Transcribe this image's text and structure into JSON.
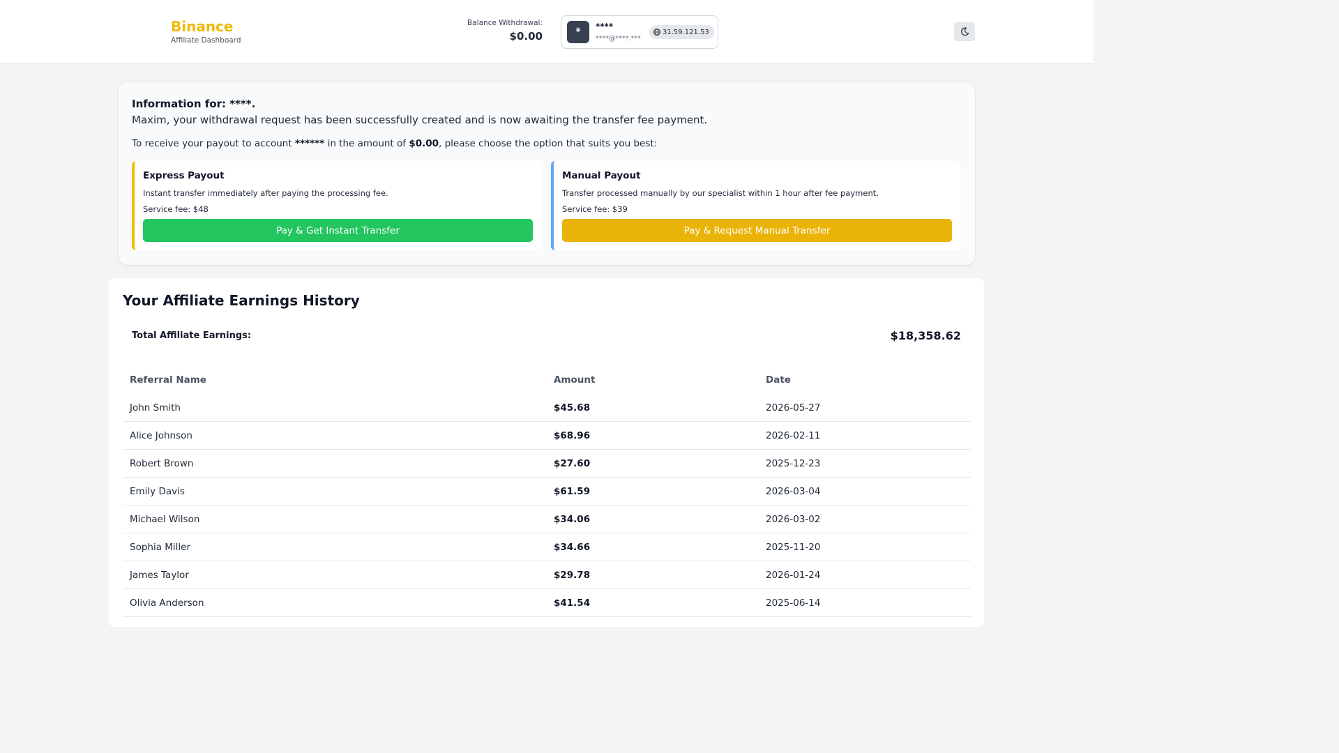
{
  "header": {
    "brand_name": "Binance",
    "brand_subtitle": "Affiliate Dashboard",
    "balance_label": "Balance Withdrawal:",
    "balance_value": "$0.00",
    "user": {
      "avatar_initial": "*",
      "name": "****",
      "email": "****@****.***",
      "ip": "31.59.121.53"
    },
    "theme_toggle_icon": "moon-icon"
  },
  "info": {
    "title": "Information for: ****.",
    "message": "Maxim, your withdrawal request has been successfully created and is now awaiting the transfer fee payment.",
    "line_prefix": "To receive your payout to account ",
    "account": "******",
    "line_middle": " in the amount of ",
    "amount": "$0.00",
    "line_suffix": ", please choose the option that suits you best:"
  },
  "options": {
    "express": {
      "title": "Express Payout",
      "description": "Instant transfer immediately after paying the processing fee.",
      "fee": "Service fee: $48",
      "button": "Pay & Get Instant Transfer",
      "accent": "#f0c000",
      "button_color": "#22c55e"
    },
    "manual": {
      "title": "Manual Payout",
      "description": "Transfer processed manually by our specialist within 1 hour after fee payment.",
      "fee": "Service fee: $39",
      "button": "Pay & Request Manual Transfer",
      "accent": "#60a5fa",
      "button_color": "#eab308"
    }
  },
  "history": {
    "title": "Your Affiliate Earnings History",
    "total_label": "Total Affiliate Earnings:",
    "total_value": "$18,358.62",
    "columns": [
      "Referral Name",
      "Amount",
      "Date"
    ],
    "rows": [
      {
        "name": "John Smith",
        "amount": "$45.68",
        "date": "2026-05-27"
      },
      {
        "name": "Alice Johnson",
        "amount": "$68.96",
        "date": "2026-02-11"
      },
      {
        "name": "Robert Brown",
        "amount": "$27.60",
        "date": "2025-12-23"
      },
      {
        "name": "Emily Davis",
        "amount": "$61.59",
        "date": "2026-03-04"
      },
      {
        "name": "Michael Wilson",
        "amount": "$34.06",
        "date": "2026-03-02"
      },
      {
        "name": "Sophia Miller",
        "amount": "$34.66",
        "date": "2025-11-20"
      },
      {
        "name": "James Taylor",
        "amount": "$29.78",
        "date": "2026-01-24"
      },
      {
        "name": "Olivia Anderson",
        "amount": "$41.54",
        "date": "2025-06-14"
      }
    ]
  }
}
